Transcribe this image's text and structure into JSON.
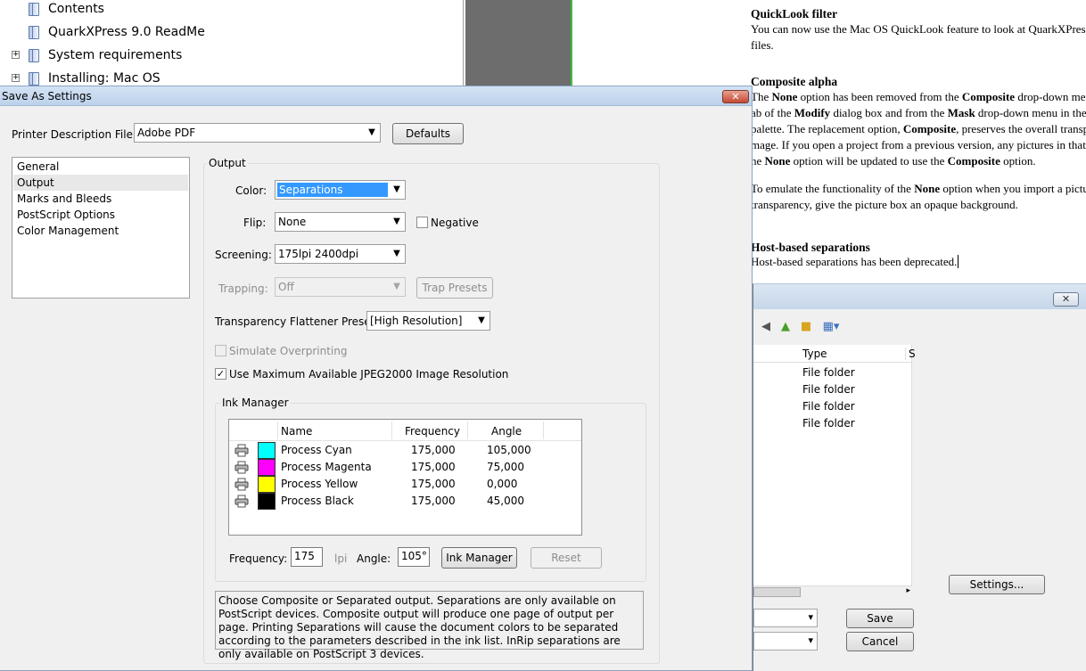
{
  "help_tree": {
    "items": [
      {
        "label": "Contents",
        "expandable": false
      },
      {
        "label": "QuarkXPress 9.0 ReadMe",
        "expandable": false
      },
      {
        "label": "System requirements",
        "expandable": true
      },
      {
        "label": "Installing: Mac OS",
        "expandable": true
      }
    ],
    "expand_glyph": "+"
  },
  "document": {
    "quicklook_heading": "QuickLook filter",
    "quicklook_line1": "You can now use the Mac OS QuickLook feature to look at QuarkXPress and",
    "quicklook_line2": "files.",
    "alpha_heading": "Composite alpha",
    "alpha_l1_a": "The ",
    "alpha_l1_b": "None",
    "alpha_l1_c": " option has been removed from the ",
    "alpha_l1_d": "Composite",
    "alpha_l1_e": " drop-down menu in",
    "alpha_l2_a": "ab of the ",
    "alpha_l2_b": "Modify",
    "alpha_l2_c": " dialog box and from the ",
    "alpha_l2_d": "Mask",
    "alpha_l2_e": " drop-down menu in the",
    "alpha_l3_a": "palette. The replacement option, ",
    "alpha_l3_b": "Composite",
    "alpha_l3_c": ", preserves the overall transparency",
    "alpha_l4": "mage. If you open a project from a previous version, any pictures in that",
    "alpha_l5_a": "he ",
    "alpha_l5_b": "None",
    "alpha_l5_c": " option will be updated to use the ",
    "alpha_l5_d": "Composite",
    "alpha_l5_e": " option.",
    "emulate_l1_a": "To emulate the functionality of the ",
    "emulate_l1_b": "None",
    "emulate_l1_c": " option when you import a picture",
    "emulate_l2": "transparency, give the picture box an opaque background.",
    "host_heading": "Host-based separations",
    "host_line": "Host-based separations has been deprecated."
  },
  "file_dialog": {
    "close_glyph": "✕",
    "type_header": "Type",
    "extra_header": "S",
    "rows": [
      "File folder",
      "File folder",
      "File folder",
      "File folder"
    ],
    "settings_label": "Settings...",
    "save_label": "Save",
    "cancel_label": "Cancel"
  },
  "dialog": {
    "title": "Save As Settings",
    "close_glyph": "✕",
    "printer_description_label": "Printer Description File:",
    "printer_description_value": "Adobe PDF",
    "defaults_label": "Defaults",
    "side_items": [
      "General",
      "Output",
      "Marks and Bleeds",
      "PostScript Options",
      "Color Management"
    ],
    "output_group_title": "Output",
    "color_label": "Color:",
    "color_value": "Separations",
    "flip_label": "Flip:",
    "flip_value": "None",
    "negative_label": "Negative",
    "negative_checked": false,
    "screening_label": "Screening:",
    "screening_value": "175lpi 2400dpi",
    "trapping_label": "Trapping:",
    "trapping_value": "Off",
    "trap_presets_label": "Trap Presets",
    "flattener_label": "Transparency Flattener Preset:",
    "flattener_value": "[High Resolution]",
    "simulate_label": "Simulate Overprinting",
    "simulate_checked": false,
    "jpeg_label": "Use Maximum Available JPEG2000 Image Resolution",
    "jpeg_checked": true,
    "check_glyph": "✓",
    "ink_group_title": "Ink Manager",
    "ink_headers": {
      "name": "Name",
      "frequency": "Frequency",
      "angle": "Angle"
    },
    "inks": [
      {
        "name": "Process Cyan",
        "frequency": "175,000",
        "angle": "105,000",
        "color": "#00ffff"
      },
      {
        "name": "Process Magenta",
        "frequency": "175,000",
        "angle": "75,000",
        "color": "#ff00ff"
      },
      {
        "name": "Process Yellow",
        "frequency": "175,000",
        "angle": "0,000",
        "color": "#ffff00"
      },
      {
        "name": "Process Black",
        "frequency": "175,000",
        "angle": "45,000",
        "color": "#000000"
      }
    ],
    "frequency_label": "Frequency:",
    "frequency_value": "175",
    "lpi_label": "lpi",
    "angle_label": "Angle:",
    "angle_value": "105°",
    "ink_manager_button": "Ink Manager",
    "reset_button": "Reset",
    "description": "Choose Composite or Separated output. Separations are only available on PostScript devices. Composite output will produce one page of output per page. Printing Separations will cause the document colors to be separated according to the parameters described in the ink list. InRip separations are only available on PostScript 3 devices."
  }
}
